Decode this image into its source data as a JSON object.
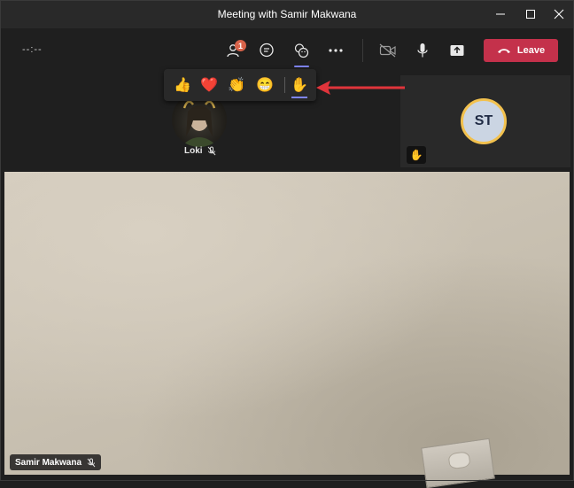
{
  "window": {
    "title": "Meeting with Samir Makwana"
  },
  "toolbar": {
    "timer": "--:--",
    "participants_badge": "1",
    "leave_label": "Leave"
  },
  "reactions": [
    {
      "name": "like",
      "emoji": "👍"
    },
    {
      "name": "heart",
      "emoji": "❤️"
    },
    {
      "name": "applause",
      "emoji": "👏"
    },
    {
      "name": "laugh",
      "emoji": "😁"
    },
    {
      "name": "raise-hand",
      "emoji": "✋"
    }
  ],
  "participants": {
    "loki": {
      "name": "Loki"
    },
    "st": {
      "initials": "ST"
    },
    "main": {
      "name": "Samir Makwana"
    }
  },
  "colors": {
    "accent": "#7f85f5",
    "leave": "#c4314b",
    "badge": "#d8634a",
    "raised_hand_ring": "#f2c14e",
    "arrow": "#e0343b"
  }
}
